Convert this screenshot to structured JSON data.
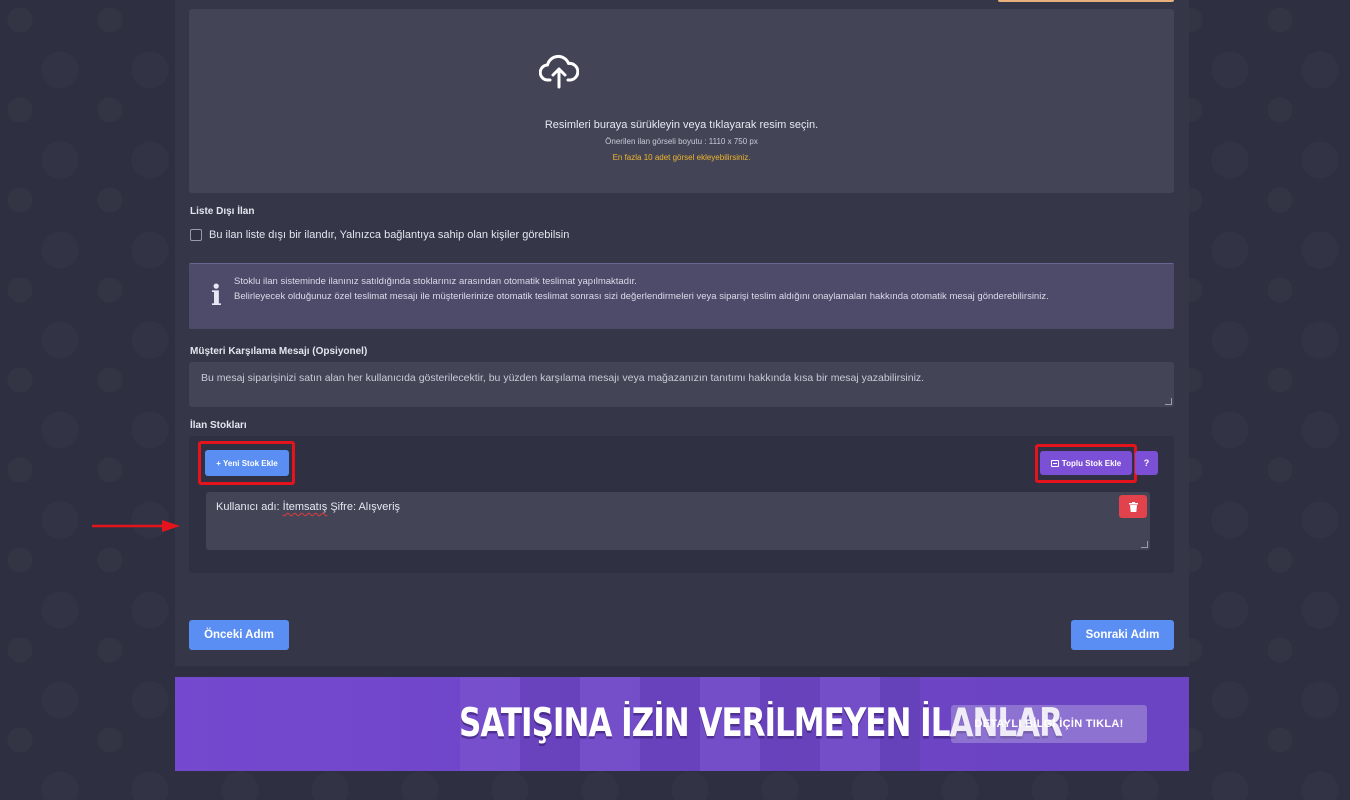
{
  "upload": {
    "main": "Resimleri buraya sürükleyin veya tıklayarak resim seçin.",
    "sub": "Önerilen ilan görseli boyutu : 1110 x 750 px",
    "warning": "En fazla 10 adet görsel ekleyebilirsiniz.",
    "icon": "cloud-upload-icon"
  },
  "unlisted": {
    "label": "Liste Dışı İlan",
    "checkbox_text": "Bu ilan liste dışı bir ilandır, Yalnızca bağlantıya sahip olan kişiler görebilsin",
    "checked": false
  },
  "info": {
    "icon": "info-icon",
    "line1": "Stoklu ilan sisteminde ilanınız satıldığında stoklarınız arasından otomatik teslimat yapılmaktadır.",
    "line2": "Belirleyecek olduğunuz özel teslimat mesajı ile müşterilerinize otomatik teslimat sonrası sizi değerlendirmeleri veya siparişi teslim aldığını onaylamaları hakkında otomatik mesaj gönderebilirsiniz."
  },
  "welcome": {
    "label": "Müşteri Karşılama Mesajı (Opsiyonel)",
    "placeholder": "Bu mesaj siparişinizi satın alan her kullanıcıda gösterilecektir, bu yüzden karşılama mesajı veya mağazanızın tanıtımı hakkında kısa bir mesaj yazabilirsiniz."
  },
  "stocks": {
    "label": "İlan Stokları",
    "add_button": "+ Yeni Stok Ekle",
    "bulk_button": "Toplu Stok Ekle",
    "bulk_icon": "list-icon",
    "help_button": "?",
    "delete_icon": "trash-icon",
    "item_prefix": "Kullanıcı adı: ",
    "item_user": "İtemsatış",
    "item_suffix": " Şifre: Alışveriş"
  },
  "nav": {
    "prev": "Önceki Adım",
    "next": "Sonraki Adım"
  },
  "banner": {
    "title": "SATIŞINA İZİN VERİLMEYEN İLANLAR",
    "button": "DETAYLI BİLGİ İÇİN TIKLA!"
  },
  "colors": {
    "primary": "#5b8ef2",
    "purple": "#7b4fd6",
    "danger": "#e2424c",
    "highlight": "#e5141c",
    "warning": "#f0b429"
  }
}
